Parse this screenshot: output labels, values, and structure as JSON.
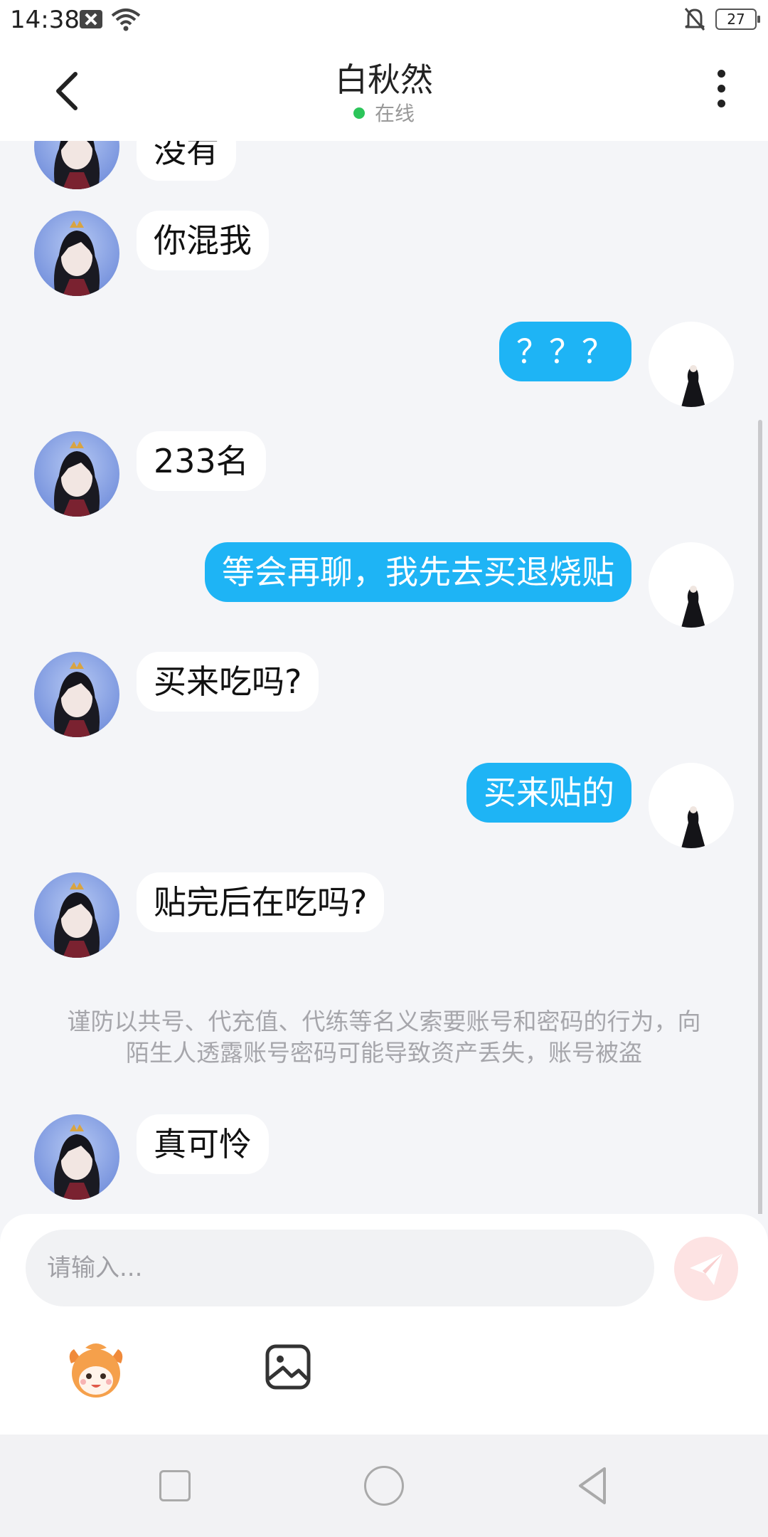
{
  "status_bar": {
    "time": "14:38",
    "battery": "27"
  },
  "header": {
    "title": "白秋然",
    "status": "在线"
  },
  "messages": [
    {
      "from": "other",
      "text": "没有"
    },
    {
      "from": "other",
      "text": "你混我"
    },
    {
      "from": "me",
      "text": "？？？"
    },
    {
      "from": "other",
      "text": "233名"
    },
    {
      "from": "me",
      "text": "等会再聊，我先去买退烧贴"
    },
    {
      "from": "other",
      "text": "买来吃吗?"
    },
    {
      "from": "me",
      "text": "买来贴的"
    },
    {
      "from": "other",
      "text": "贴完后在吃吗?"
    },
    {
      "from": "other",
      "text": "真可怜"
    }
  ],
  "notice": "谨防以共号、代充值、代练等名义索要账号和密码的行为，向陌生人透露账号密码可能导致资产丢失，账号被盗",
  "input": {
    "placeholder": "请输入..."
  },
  "icons": {
    "back": "back-arrow-icon",
    "more": "more-vertical-icon",
    "send": "paper-plane-icon",
    "emoji": "emoji-mascot-icon",
    "image": "image-icon"
  },
  "colors": {
    "my_bubble": "#1eb4f5",
    "other_bubble": "#ffffff",
    "online_dot": "#2cc55a",
    "send_button": "#fde3e3"
  }
}
